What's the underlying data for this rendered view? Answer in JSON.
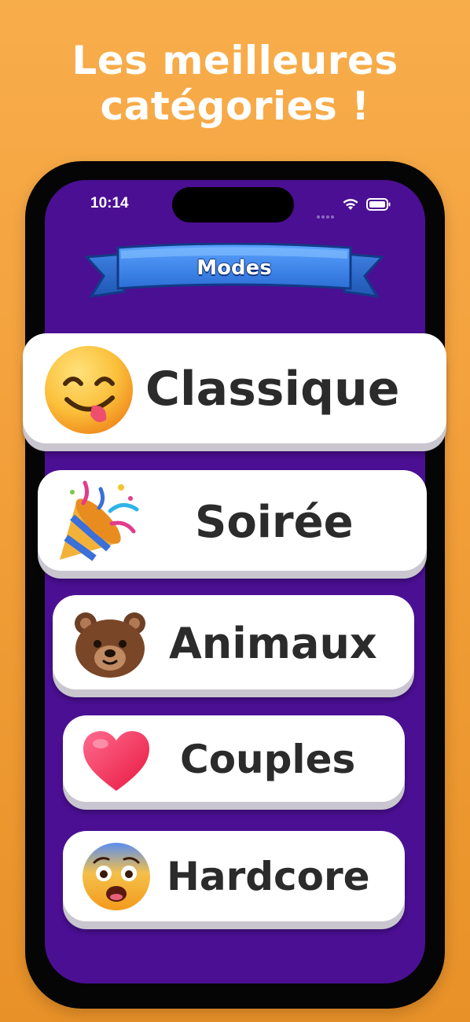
{
  "headline": {
    "line1": "Les meilleures",
    "line2": "catégories !"
  },
  "status_bar": {
    "time": "10:14"
  },
  "header": {
    "title": "Modes"
  },
  "modes": [
    {
      "label": "Classique",
      "icon": "savoring-face-icon"
    },
    {
      "label": "Soirée",
      "icon": "party-popper-icon"
    },
    {
      "label": "Animaux",
      "icon": "bear-face-icon"
    },
    {
      "label": "Couples",
      "icon": "red-heart-icon"
    },
    {
      "label": "Hardcore",
      "icon": "fearful-face-icon"
    }
  ],
  "colors": {
    "background": "#f3a13c",
    "screen": "#4b0f93",
    "ribbon": "#3f86e6",
    "card": "#ffffff",
    "card_text": "#2b2b2b"
  }
}
